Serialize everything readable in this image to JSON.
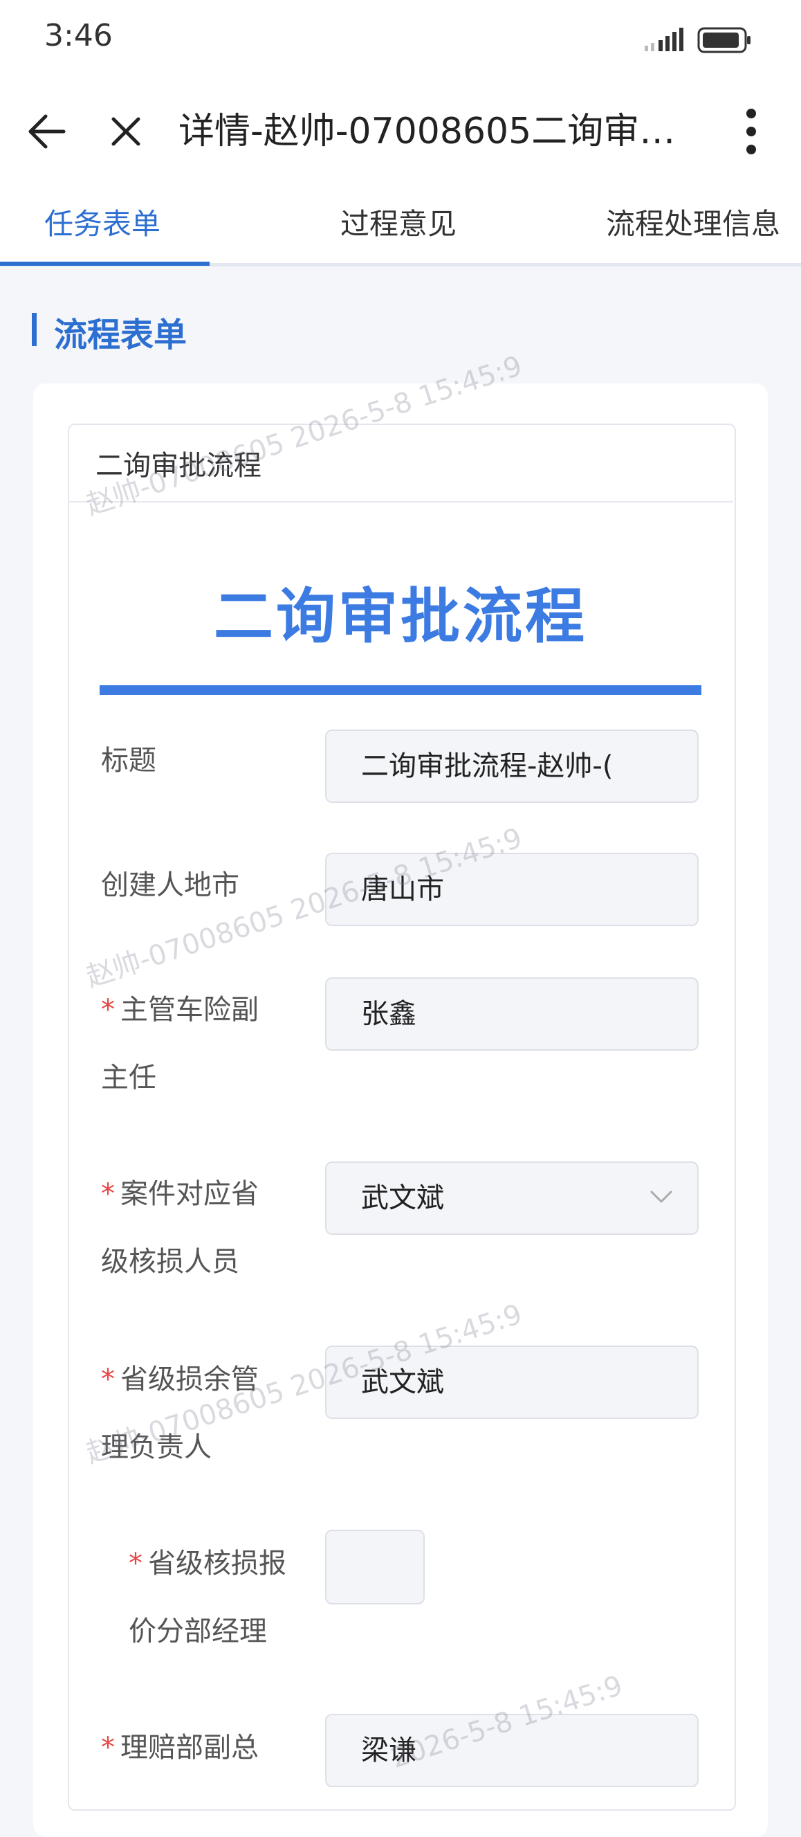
{
  "status": {
    "time": "3:46"
  },
  "nav": {
    "title": "详情-赵帅-07008605二询审…"
  },
  "tabs": [
    {
      "label": "任务表单",
      "active": true
    },
    {
      "label": "过程意见",
      "active": false
    },
    {
      "label": "流程处理信息",
      "active": false
    }
  ],
  "section": {
    "title": "流程表单"
  },
  "card": {
    "header": "二询审批流程"
  },
  "form": {
    "title": "二询审批流程",
    "fields": [
      {
        "label": "标题",
        "required": false,
        "value": "二询审批流程-赵帅-("
      },
      {
        "label": "创建人地市",
        "required": false,
        "value": "唐山市"
      },
      {
        "label_line1": "主管车险副",
        "label_line2": "主任",
        "required": true,
        "value": "张鑫"
      },
      {
        "label_line1": "案件对应省",
        "label_line2": "级核损人员",
        "required": true,
        "value": "武文斌",
        "dropdown": true
      },
      {
        "label_line1": "省级损余管",
        "label_line2": "理负责人",
        "required": true,
        "value": "武文斌"
      },
      {
        "label_line1": "省级核损报",
        "label_line2": "价分部经理",
        "required": true,
        "value": ""
      },
      {
        "label_line1": "理赔部副总",
        "required": true,
        "value": "梁谦"
      }
    ],
    "required_mark": "*"
  },
  "watermark": {
    "name": "赵帅-07008605",
    "date": "2026-5-8 15:45:9"
  },
  "colors": {
    "accent": "#2d6fd1",
    "title_blue": "#3b7be2",
    "required": "#e64545"
  }
}
